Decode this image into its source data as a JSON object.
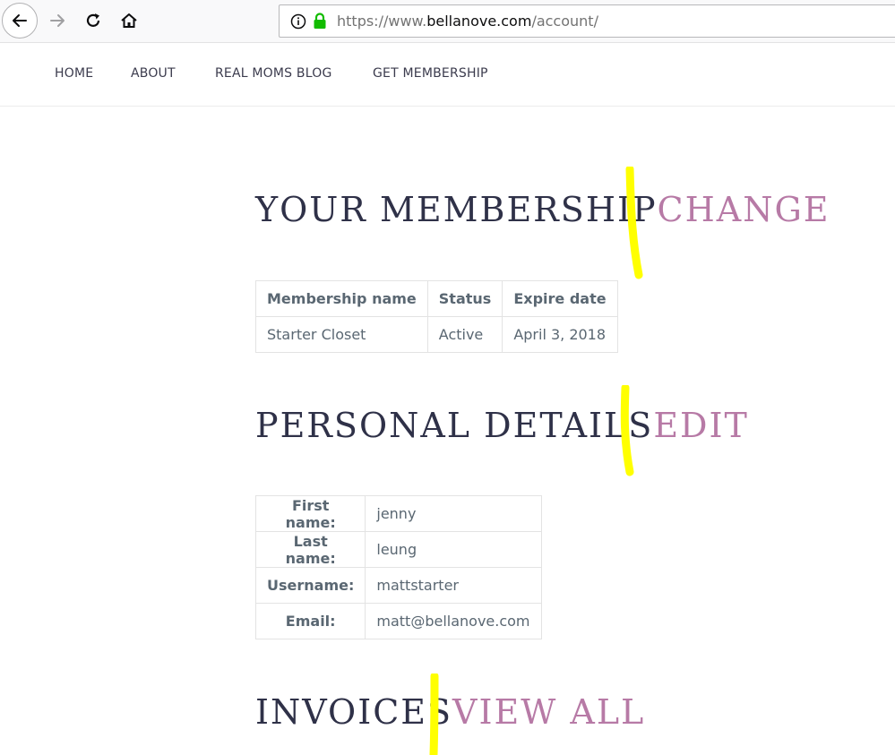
{
  "browser": {
    "url_prefix": "https://www.",
    "url_host": "bellanove.com",
    "url_path": "/account/",
    "icons": [
      "back-arrow-icon",
      "forward-arrow-icon",
      "reload-icon",
      "home-icon",
      "info-icon",
      "lock-icon"
    ],
    "lock_color": "#12bc00"
  },
  "site_nav": {
    "items": [
      "HOME",
      "ABOUT",
      "REAL MOMS BLOG",
      "GET MEMBERSHIP"
    ]
  },
  "membership": {
    "title": "YOUR MEMBERSHIP",
    "link": "CHANGE",
    "headers": [
      "Membership name",
      "Status",
      "Expire date"
    ],
    "row": [
      "Starter Closet",
      "Active",
      "April 3, 2018"
    ]
  },
  "personal": {
    "title": "PERSONAL DETAILS",
    "link": "EDIT",
    "rows": [
      {
        "label": "First name:",
        "value": "jenny"
      },
      {
        "label": "Last name:",
        "value": "leung"
      },
      {
        "label": "Username:",
        "value": "mattstarter"
      },
      {
        "label": "Email:",
        "value": "matt@bellanove.com"
      }
    ]
  },
  "invoices": {
    "title": "INVOICES",
    "link": "VIEW ALL"
  },
  "colors": {
    "heading": "#2f3148",
    "link_accent": "#b77aa6",
    "highlighter": "#ffff00",
    "body_text": "#5a6772"
  }
}
